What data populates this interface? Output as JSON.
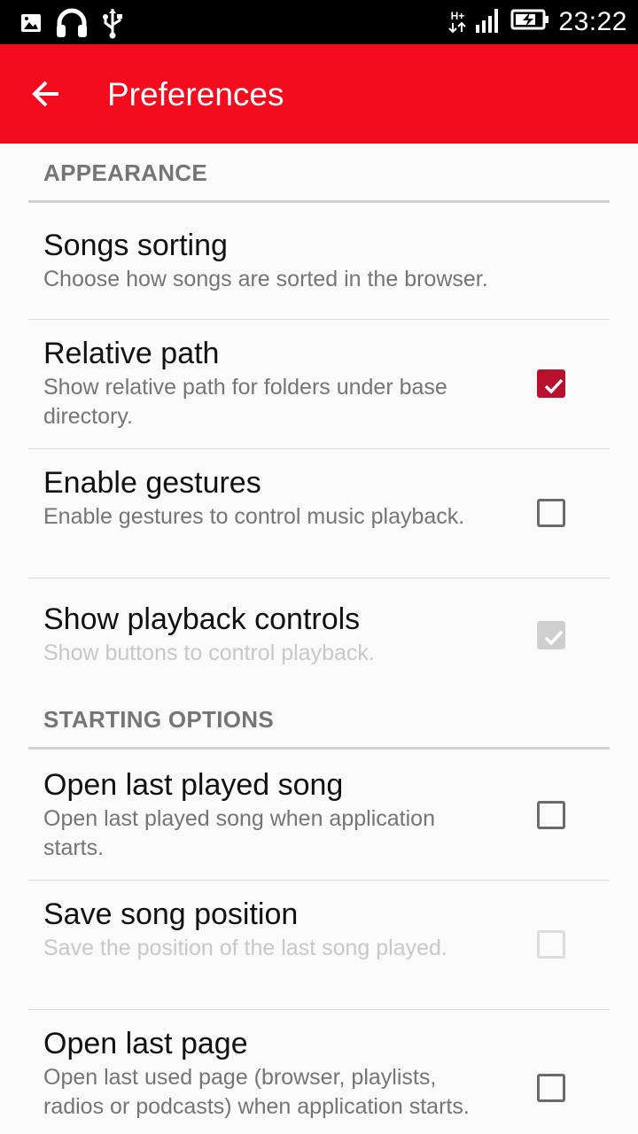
{
  "status_bar": {
    "time": "23:22",
    "network_type": "H+",
    "icons": [
      "image-icon",
      "headphones-icon",
      "usb-icon",
      "network-icon",
      "signal-icon",
      "battery-charging-icon"
    ]
  },
  "app_bar": {
    "title": "Preferences",
    "back_icon": "arrow-left-icon",
    "color": "#f20c1e"
  },
  "sections": [
    {
      "header": "APPEARANCE",
      "items": [
        {
          "title": "Songs sorting",
          "summary": "Choose how songs are sorted in the browser.",
          "checkbox": null,
          "enabled": true
        },
        {
          "title": "Relative path",
          "summary": "Show relative path for folders under base directory.",
          "checkbox": "checked",
          "enabled": true
        },
        {
          "title": "Enable gestures",
          "summary": "Enable gestures to control music playback.",
          "checkbox": "unchecked",
          "enabled": true
        },
        {
          "title": "Show playback controls",
          "summary": "Show buttons to control playback.",
          "checkbox": "checked",
          "enabled": false
        }
      ]
    },
    {
      "header": "STARTING OPTIONS",
      "items": [
        {
          "title": "Open last played song",
          "summary": "Open last played song when application starts.",
          "checkbox": "unchecked",
          "enabled": true
        },
        {
          "title": "Save song position",
          "summary": "Save the position of the last song played.",
          "checkbox": "unchecked",
          "enabled": false
        },
        {
          "title": "Open last page",
          "summary": "Open last used page (browser, playlists, radios or podcasts) when application starts.",
          "checkbox": "unchecked",
          "enabled": true
        }
      ]
    }
  ],
  "colors": {
    "accent": "#b7112e",
    "section_header": "#757575",
    "summary": "#757575",
    "disabled_text": "#c8c8c8"
  }
}
